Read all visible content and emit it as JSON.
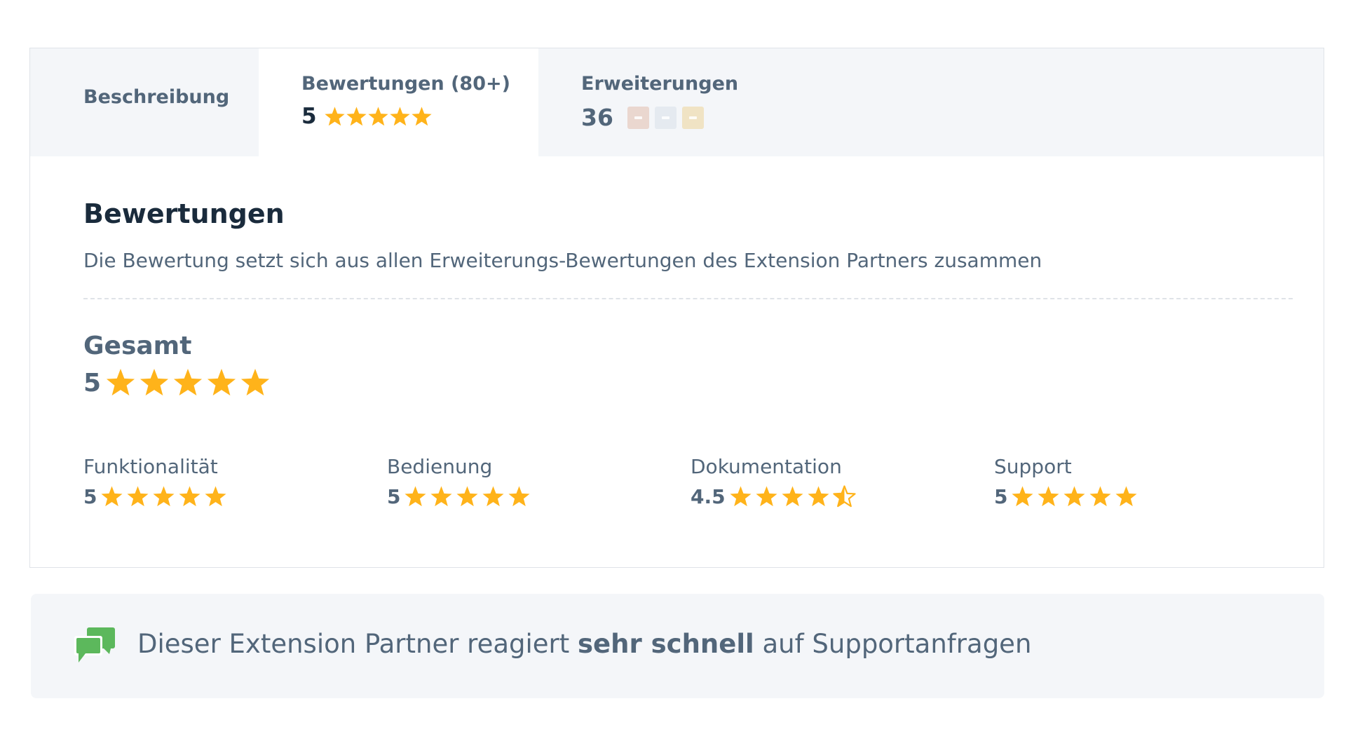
{
  "colors": {
    "star": "#ffb31a",
    "text": "#52667a",
    "heading": "#1a2b3c",
    "tabbar_bg": "#f4f6f9",
    "support_icon": "#5cb85c",
    "badge_bronze": "#ead7cf",
    "badge_silver": "#e5eaf0",
    "badge_gold": "#f0e3c4"
  },
  "tabs": {
    "description": {
      "label": "Beschreibung"
    },
    "reviews": {
      "label": "Bewertungen (80+)",
      "rating": "5",
      "stars": 5
    },
    "extensions": {
      "label": "Erweiterungen",
      "count": "36",
      "badges": [
        "bronze",
        "silver",
        "gold"
      ]
    }
  },
  "reviews": {
    "heading": "Bewertungen",
    "description": "Die Bewertung setzt sich aus allen Erweiterungs-Bewertungen des Extension Partners zusammen",
    "overall": {
      "label": "Gesamt",
      "rating": "5",
      "stars": 5
    },
    "categories": [
      {
        "label": "Funktionalität",
        "rating": "5",
        "stars": 5
      },
      {
        "label": "Bedienung",
        "rating": "5",
        "stars": 5
      },
      {
        "label": "Dokumentation",
        "rating": "4.5",
        "stars": 4.5
      },
      {
        "label": "Support",
        "rating": "5",
        "stars": 5
      }
    ]
  },
  "support": {
    "icon": "chat-bubbles-icon",
    "text_before": "Dieser Extension Partner reagiert ",
    "text_bold": "sehr schnell",
    "text_after": " auf Supportanfragen"
  }
}
